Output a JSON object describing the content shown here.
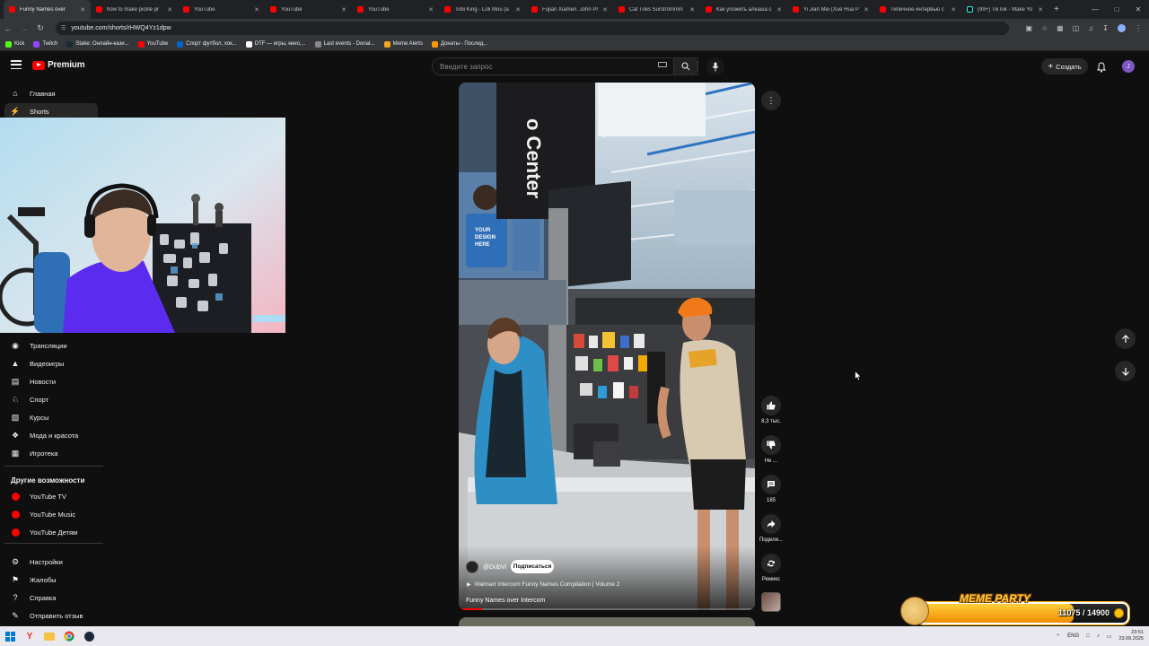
{
  "browser": {
    "tabs": [
      {
        "title": "Funny Names over",
        "active": true,
        "icon": "youtube-favicon"
      },
      {
        "title": "how to make pickle pr",
        "active": false,
        "icon": "youtube-favicon"
      },
      {
        "title": "YouTube",
        "active": false,
        "icon": "youtube-favicon"
      },
      {
        "title": "YouTube",
        "active": false,
        "icon": "youtube-favicon"
      },
      {
        "title": "YouTube",
        "active": false,
        "icon": "youtube-favicon"
      },
      {
        "title": "Tobi King - Loli Mou (a",
        "active": false,
        "icon": "youtube-favicon"
      },
      {
        "title": "Fujian Xiamen. John Pr",
        "active": false,
        "icon": "youtube-favicon"
      },
      {
        "title": "Cat Tries Surströmmin",
        "active": false,
        "icon": "youtube-favicon"
      },
      {
        "title": "Как уложить алкаша с",
        "active": false,
        "icon": "youtube-favicon"
      },
      {
        "title": "Yi Jian Mei (Xue Hua P",
        "active": false,
        "icon": "youtube-favicon"
      },
      {
        "title": "Типичное интервью с",
        "active": false,
        "icon": "youtube-favicon"
      },
      {
        "title": "(99+) TikTok - Make Yo",
        "active": false,
        "icon": "tiktok-favicon"
      }
    ],
    "url": "youtube.com/shorts/rHWQ4Yz1dpw",
    "bookmarks": [
      {
        "label": "Kick",
        "color": "#53fc18"
      },
      {
        "label": "Twitch",
        "color": "#9146ff"
      },
      {
        "label": "Stake: Онлайн-кази...",
        "color": "#1a2c38"
      },
      {
        "label": "YouTube",
        "color": "#ff0000"
      },
      {
        "label": "Спорт футбол, хок...",
        "color": "#0066cc"
      },
      {
        "label": "DTF — игры, кино,...",
        "color": "#ffffff"
      },
      {
        "label": "Last events - Donat...",
        "color": "#888888"
      },
      {
        "label": "Meme Alerts",
        "color": "#f5a623"
      },
      {
        "label": "Донаты - Послед...",
        "color": "#ff9800"
      }
    ]
  },
  "header": {
    "logo_text": "Premium",
    "search_placeholder": "Введите запрос",
    "create_label": "Создать",
    "avatar_letter": "J",
    "brand_color": "#ff0000"
  },
  "sidebar": {
    "top_items": [
      {
        "label": "Главная",
        "icon": "home-icon",
        "active": false
      },
      {
        "label": "Shorts",
        "icon": "shorts-icon",
        "active": true
      }
    ],
    "explore_items": [
      {
        "label": "Трансляции",
        "icon": "live-icon"
      },
      {
        "label": "Видеоигры",
        "icon": "gaming-icon"
      },
      {
        "label": "Новости",
        "icon": "news-icon"
      },
      {
        "label": "Спорт",
        "icon": "trophy-icon"
      },
      {
        "label": "Курсы",
        "icon": "courses-icon"
      },
      {
        "label": "Мода и красота",
        "icon": "fashion-icon"
      },
      {
        "label": "Игротека",
        "icon": "playables-icon"
      }
    ],
    "more_title": "Другие возможности",
    "more_items": [
      {
        "label": "YouTube TV",
        "icon": "youtube-tv-icon"
      },
      {
        "label": "YouTube Music",
        "icon": "youtube-music-icon"
      },
      {
        "label": "YouTube Детям",
        "icon": "youtube-kids-icon"
      }
    ],
    "settings_items": [
      {
        "label": "Настройки",
        "icon": "gear-icon"
      },
      {
        "label": "Жалобы",
        "icon": "flag-icon"
      },
      {
        "label": "Справка",
        "icon": "help-icon"
      },
      {
        "label": "Отправить отзыв",
        "icon": "feedback-icon"
      }
    ]
  },
  "short": {
    "channel": "@DubVi",
    "subscribe_label": "Подписаться",
    "playlist": "Walmart Intercom Funny Names Compilation | Volume 2",
    "title": "Funny Names over Intercom",
    "progress_fraction": 0.08
  },
  "actions": {
    "like_count": "8,3 тыс.",
    "dislike_label": "Не ...",
    "comment_count": "185",
    "share_label": "Подели...",
    "remix_label": "Ремикс"
  },
  "meme_widget": {
    "title": "MEME PARTY",
    "current": "11075",
    "goal": "14900",
    "count_text": "11075 / 14900",
    "fill_fraction": 0.743
  },
  "taskbar": {
    "language": "ENG",
    "time": "23:51",
    "date": "23.09.2025"
  }
}
